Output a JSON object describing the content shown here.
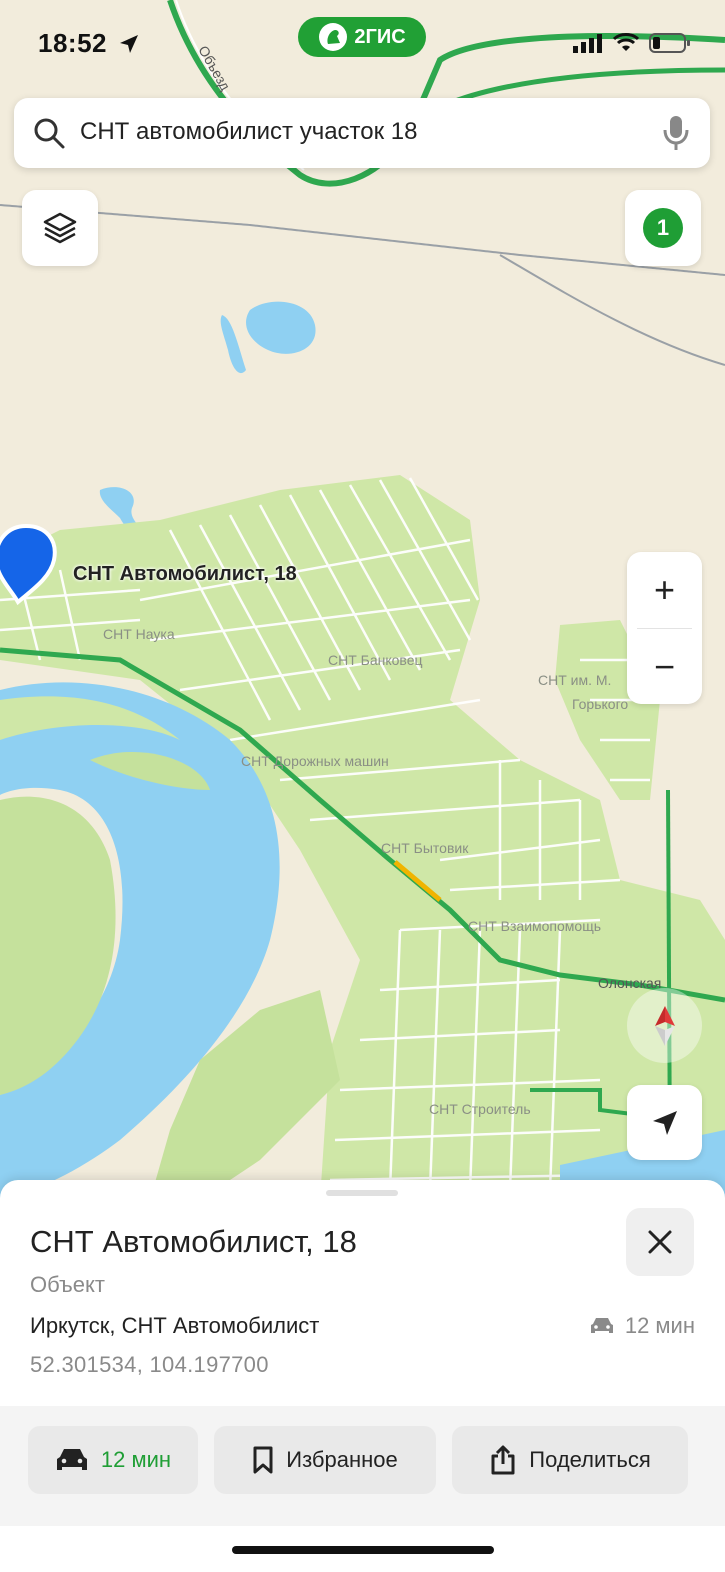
{
  "status_bar": {
    "time": "18:52",
    "brand": "2ГИС",
    "icons": [
      "location-arrow-icon",
      "signal-icon",
      "wifi-icon",
      "battery-icon"
    ]
  },
  "search": {
    "query": "СНТ автомобилист участок 18",
    "icons": [
      "search-icon",
      "microphone-icon"
    ]
  },
  "map": {
    "layers_icon": "layers-icon",
    "results_count": "1",
    "zoom_in": "+",
    "zoom_out": "−",
    "pin_label": "СНТ Автомобилист, 18",
    "places": [
      "СНТ Наука",
      "СНТ Банковец",
      "СНТ им. М.",
      "Горького",
      "СНТ Дорожных машин",
      "СНТ Бытовик",
      "СНТ Взаимопомощь",
      "Олонская",
      "СНТ Строитель",
      "Объезд"
    ],
    "colors": {
      "water": "#8fd0f2",
      "green": "#cfe7a7",
      "land": "#f2ecdc",
      "road": "#2fa84f"
    }
  },
  "sheet": {
    "title": "СНТ Автомобилист, 18",
    "subtitle": "Объект",
    "address": "Иркутск, СНТ Автомобилист",
    "coordinates": "52.301534, 104.197700",
    "eta": "12 мин",
    "actions": {
      "route": "12 мин",
      "favorite": "Избранное",
      "share": "Поделиться"
    }
  }
}
